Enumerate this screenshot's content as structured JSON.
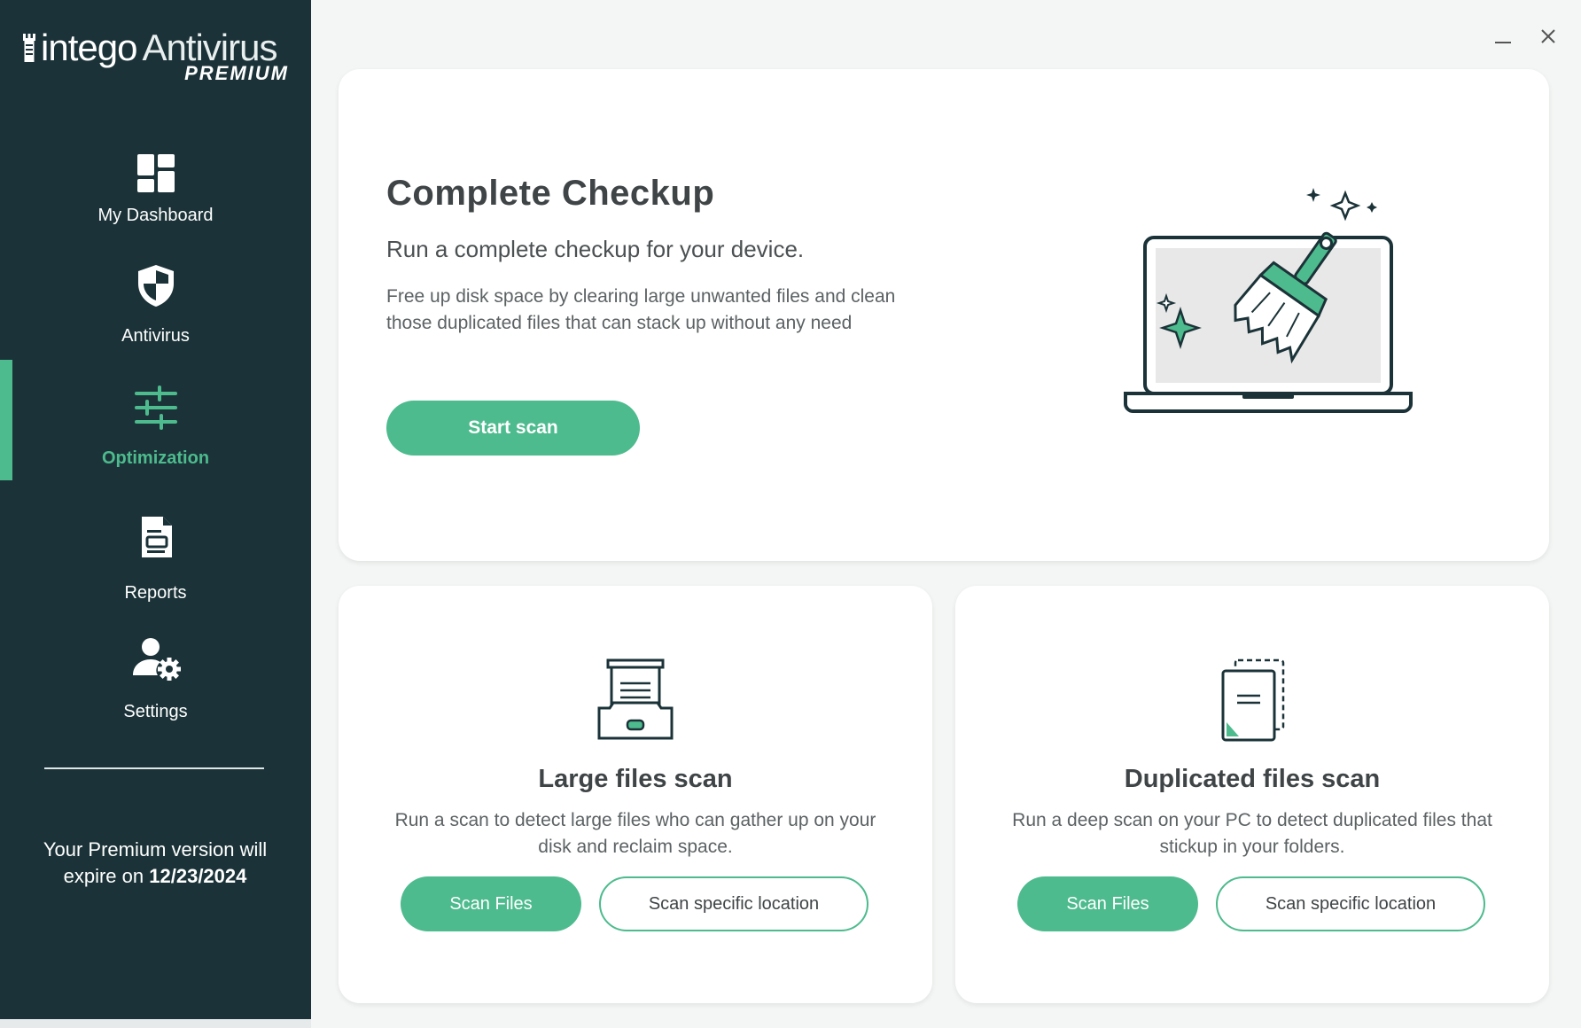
{
  "app": {
    "brand_word1": "intego",
    "brand_word2": "Antivirus",
    "edition": "PREMIUM"
  },
  "sidebar": {
    "items": [
      {
        "label": "My Dashboard",
        "icon": "dashboard-icon"
      },
      {
        "label": "Antivirus",
        "icon": "shield-icon"
      },
      {
        "label": "Optimization",
        "icon": "sliders-icon",
        "active": true
      },
      {
        "label": "Reports",
        "icon": "report-icon"
      },
      {
        "label": "Settings",
        "icon": "user-gear-icon"
      }
    ],
    "expiry_text": "Your Premium version will expire on",
    "expiry_date": "12/23/2024"
  },
  "window": {
    "minimize_icon": "minimize-icon",
    "close_icon": "close-icon"
  },
  "checkup": {
    "title": "Complete Checkup",
    "subtitle": "Run a complete checkup for your device.",
    "description": "Free up disk space by clearing large unwanted files and clean those duplicated files that can stack up without any need",
    "button": "Start scan",
    "illustration": "laptop-broom-illustration"
  },
  "large_files": {
    "icon": "file-tray-icon",
    "title": "Large files scan",
    "description": "Run a scan to detect large files who can gather up on your disk and reclaim space.",
    "primary_button": "Scan Files",
    "secondary_button": "Scan specific location"
  },
  "duplicated_files": {
    "icon": "duplicate-document-icon",
    "title": "Duplicated files scan",
    "description": "Run a deep scan on your PC to detect duplicated files that stickup in your folders.",
    "primary_button": "Scan Files",
    "secondary_button": "Scan specific location"
  },
  "colors": {
    "sidebar_bg": "#1b3338",
    "accent": "#4dbb8d",
    "text_dark": "#3f4446"
  }
}
